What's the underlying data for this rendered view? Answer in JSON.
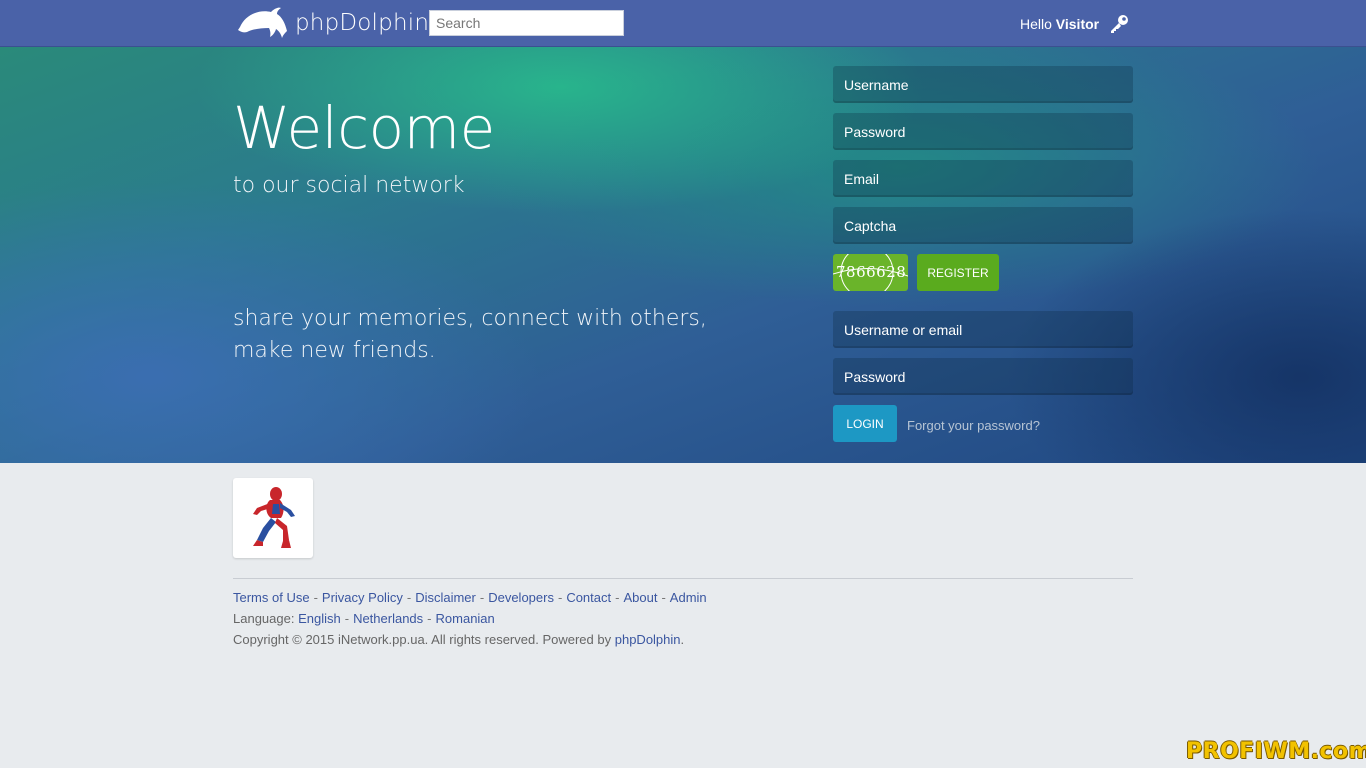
{
  "header": {
    "brand": "phpDolphin",
    "search_placeholder": "Search",
    "greeting": "Hello",
    "user": "Visitor",
    "icons": {
      "logo": "dolphin-icon",
      "login": "key-icon"
    }
  },
  "hero": {
    "title": "Welcome",
    "subtitle": "to our social network",
    "tagline": "share your memories, connect with others, make new friends."
  },
  "register_form": {
    "username_placeholder": "Username",
    "password_placeholder": "Password",
    "email_placeholder": "Email",
    "captcha_placeholder": "Captcha",
    "captcha_code": "7866628",
    "register_label": "REGISTER"
  },
  "login_form": {
    "username_placeholder": "Username or email",
    "password_placeholder": "Password",
    "login_label": "LOGIN",
    "forgot_label": "Forgot your password?"
  },
  "footer": {
    "links": [
      "Terms of Use",
      "Privacy Policy",
      "Disclaimer",
      "Developers",
      "Contact",
      "About",
      "Admin"
    ],
    "language_label": "Language:",
    "languages": [
      "English",
      "Netherlands",
      "Romanian"
    ],
    "copyright": "Copyright © 2015 iNetwork.pp.ua. All rights reserved. Powered by",
    "powered_by": "phpDolphin",
    "period": "."
  },
  "watermark": "PROFIWM.com",
  "colors": {
    "topbar": "#4a62a8",
    "register_button": "#5aab1e",
    "login_button": "#1d98c4",
    "link": "#3a56a0"
  }
}
